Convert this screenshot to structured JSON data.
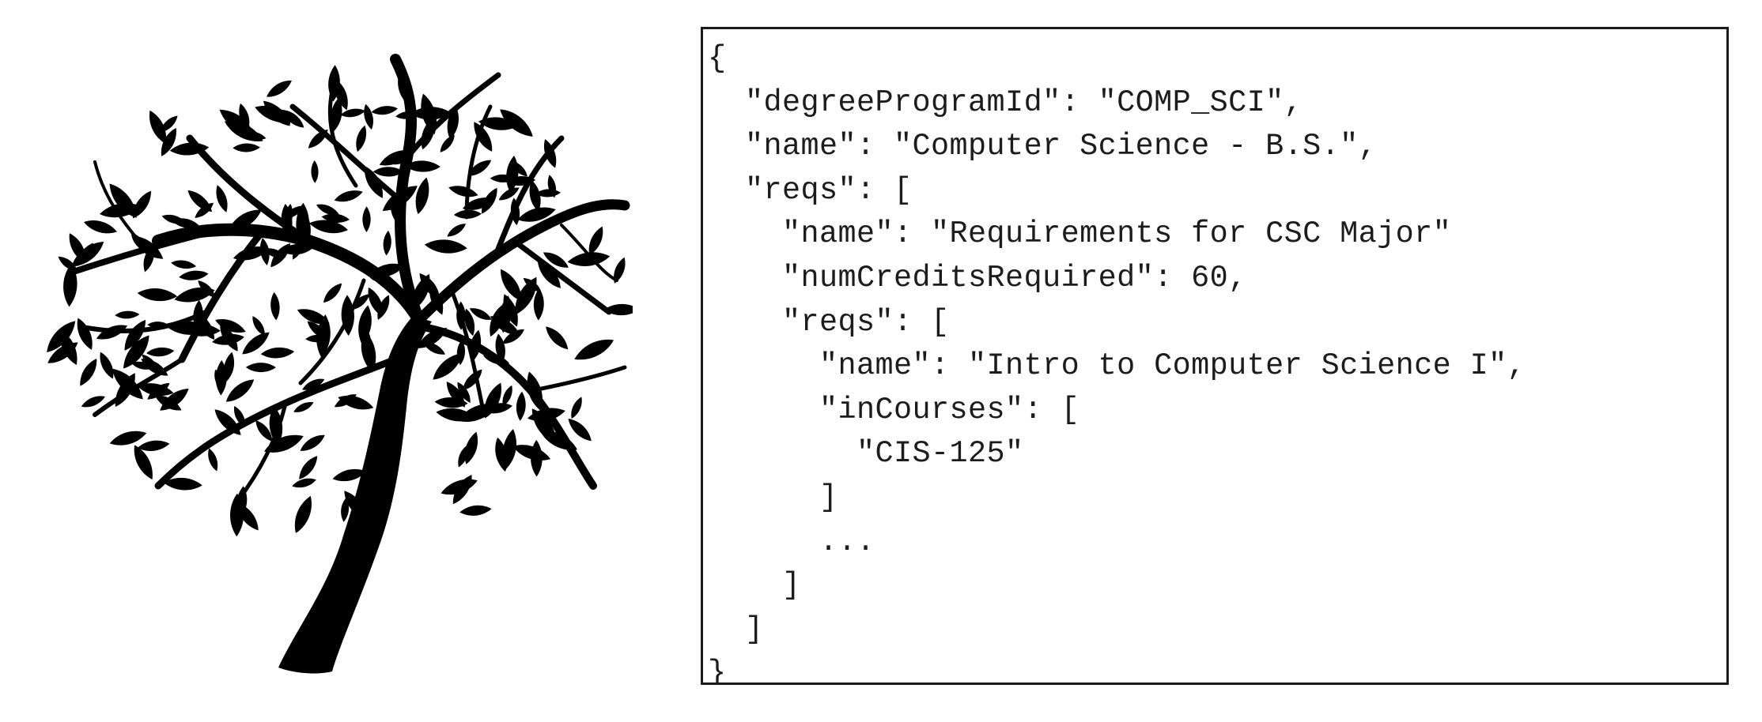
{
  "figure": {
    "tree_icon": "tree-silhouette-icon"
  },
  "json_panel": {
    "lines": [
      "{",
      "  \"degreeProgramId\": \"COMP_SCI\",",
      "  \"name\": \"Computer Science - B.S.\",",
      "  \"reqs\": [",
      "    \"name\": \"Requirements for CSC Major\"",
      "    \"numCreditsRequired\": 60,",
      "    \"reqs\": [",
      "      \"name\": \"Intro to Computer Science I\",",
      "      \"inCourses\": [",
      "        \"CIS-125\"",
      "      ]",
      "      ...",
      "    ]",
      "  ]",
      "}"
    ]
  },
  "colors": {
    "ink": "#000000",
    "code_text": "#1c1c1c",
    "border": "#1a1a1a",
    "background": "#ffffff"
  }
}
